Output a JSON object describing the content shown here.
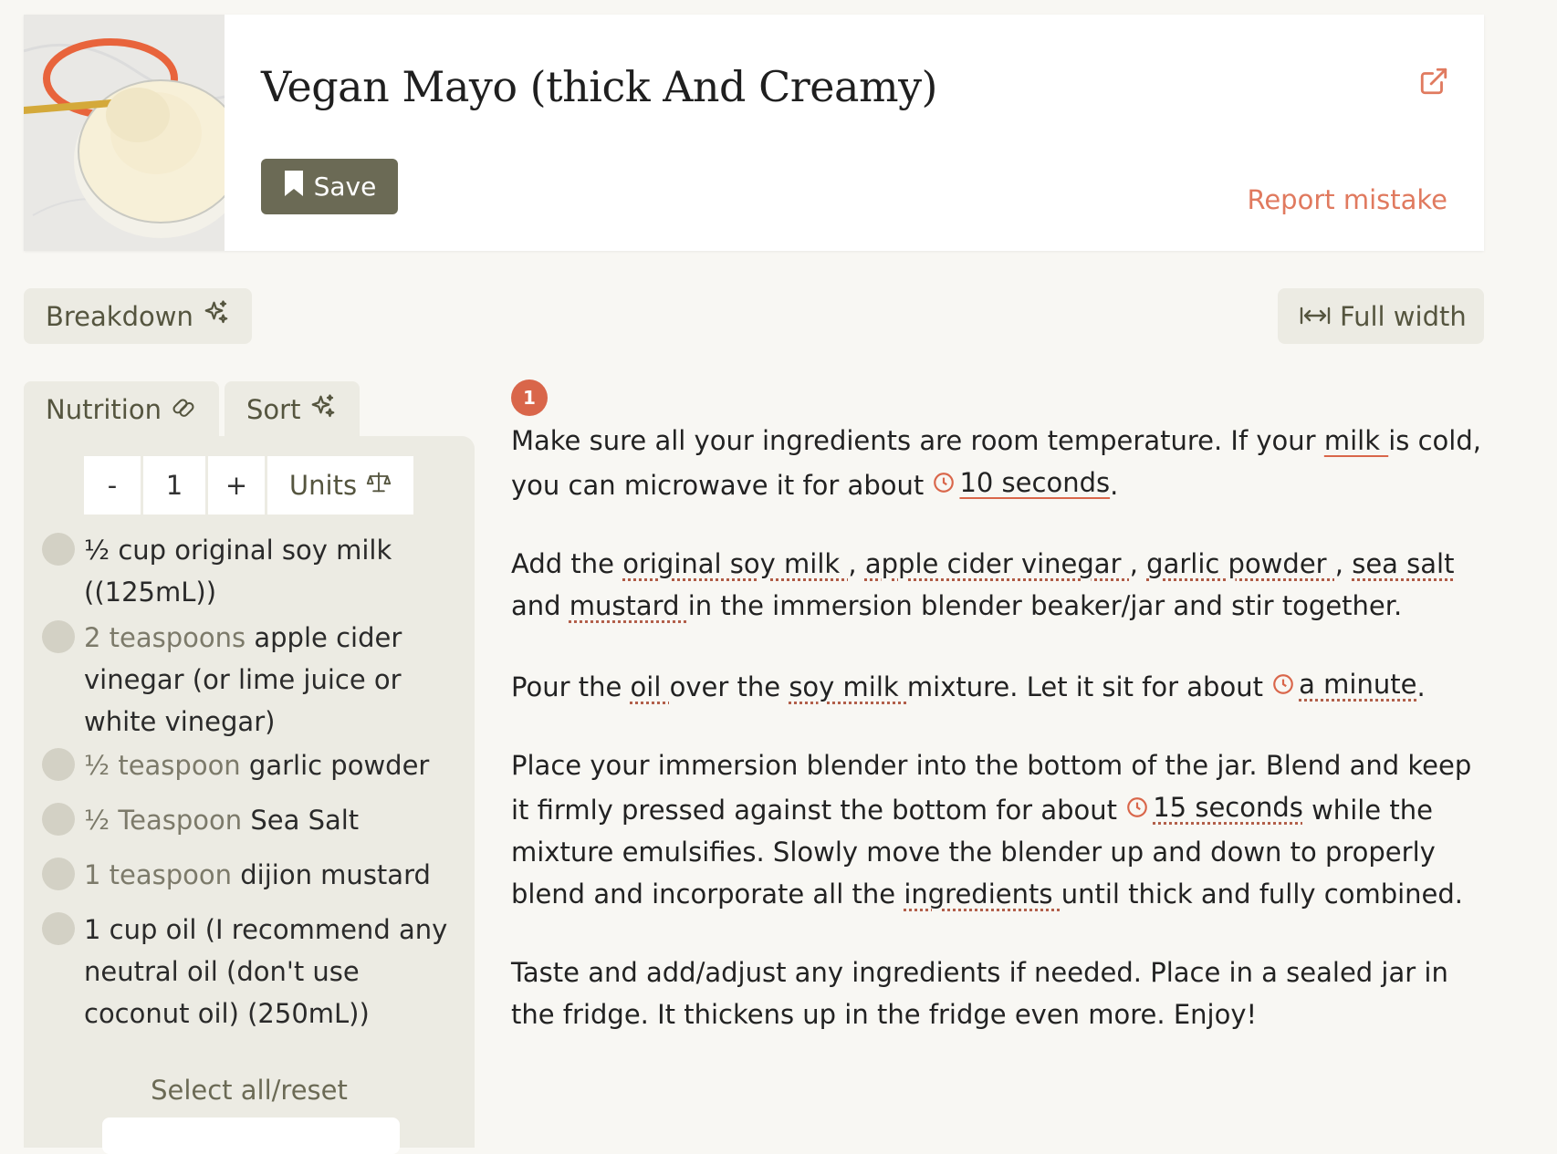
{
  "header": {
    "title": "Vegan Mayo (thick And Creamy)",
    "save_label": "Save",
    "report_label": "Report mistake"
  },
  "toolbar": {
    "breakdown_label": "Breakdown",
    "full_width_label": "Full width"
  },
  "tabs": [
    {
      "label": "Nutrition"
    },
    {
      "label": "Sort"
    }
  ],
  "servings": {
    "minus": "-",
    "value": "1",
    "plus": "+",
    "units_label": "Units"
  },
  "ingredients": [
    {
      "qty": "",
      "name": "½ cup original soy milk ((125mL))"
    },
    {
      "qty": "2 teaspoons",
      "name": "apple cider vinegar (or lime juice or white vinegar)"
    },
    {
      "qty": "½ teaspoon",
      "name": "garlic powder"
    },
    {
      "qty": "½ Teaspoon",
      "name": "Sea Salt"
    },
    {
      "qty": "1 teaspoon",
      "name": "dijion mustard"
    },
    {
      "qty": "",
      "name": "1 cup oil (I recommend any neutral oil (don't use coconut oil) (250mL))"
    }
  ],
  "select_all_label": "Select all/reset",
  "step_number": "1",
  "steps": {
    "s1": {
      "a": "Make sure all your ingredients are room temperature. If your ",
      "milk": "milk ",
      "b": "is cold, you can microwave it for about ",
      "timer": "10 seconds",
      "c": "."
    },
    "s2": {
      "a": "Add the ",
      "i1": "original soy milk ",
      "sep1": ", ",
      "i2": "apple cider vinegar ",
      "sep2": ", ",
      "i3": "garlic powder ",
      "sep3": ", ",
      "i4": "sea salt ",
      "and": "and ",
      "i5": "mustard ",
      "b": "in the immersion blender beaker/jar and stir together."
    },
    "s3": {
      "a": "Pour the ",
      "i1": "oil ",
      "b": "over the ",
      "i2": "soy milk ",
      "c": "mixture. Let it sit for about ",
      "timer": "a minute",
      "d": "."
    },
    "s4": {
      "a": "Place your immersion blender into the bottom of the jar. Blend and keep it firmly pressed against the bottom for about ",
      "timer": "15 seconds",
      "b": " while the mixture emulsifies. Slowly move the blender up and down to properly blend and incorporate all the ",
      "i1": "ingredients ",
      "c": "until thick and fully combined."
    },
    "s5": {
      "a": "Taste and add/adjust any ingredients if needed. Place in a sealed jar in the fridge. It thickens up in the fridge even more. Enjoy!"
    }
  },
  "colors": {
    "accent": "#e07a5f",
    "badge": "#d9664a",
    "save_button": "#6b6a55",
    "chip_bg": "#ecebe3",
    "page_bg": "#f8f7f3"
  },
  "icons": {
    "external": "external-link-icon",
    "bookmark": "bookmark-icon",
    "sparkle": "sparkle-icon",
    "expand": "expand-horizontal-icon",
    "pill": "pill-icon",
    "scale": "scale-icon",
    "clock": "clock-icon"
  }
}
